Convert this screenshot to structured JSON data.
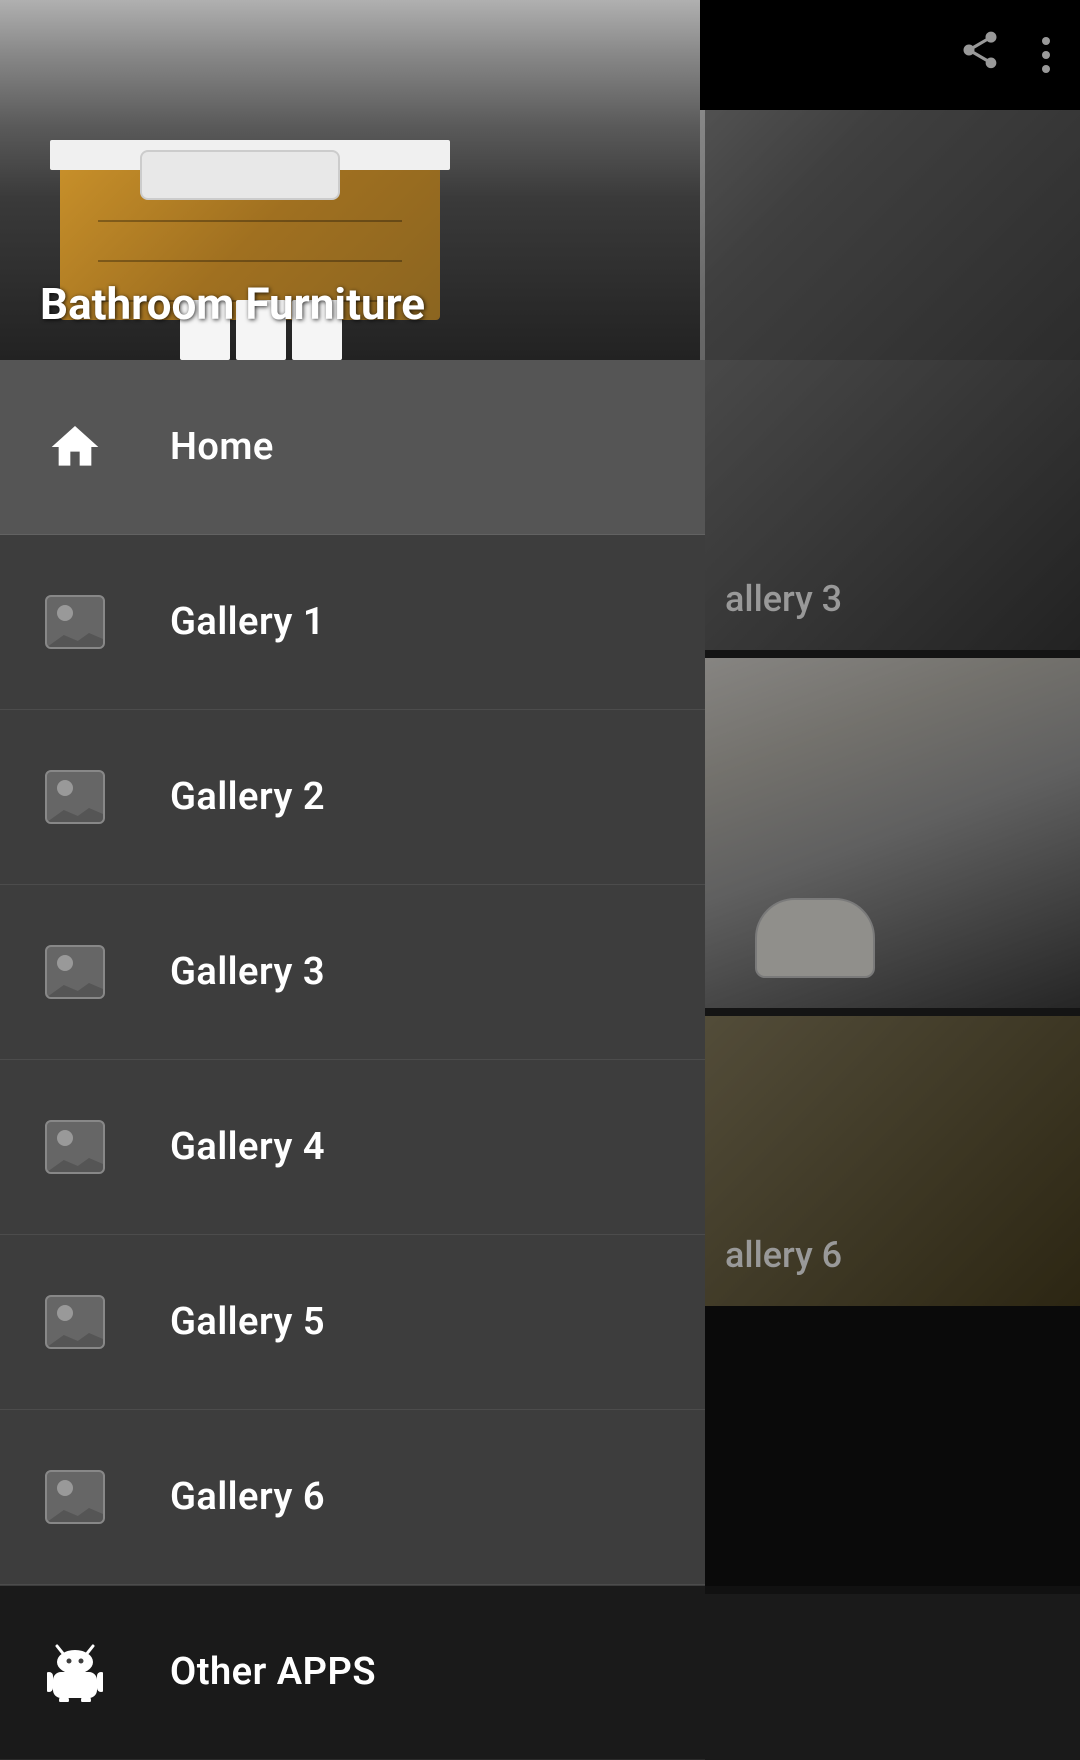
{
  "app": {
    "title": "Bathroom Furniture",
    "bg_color": "#1a1a1a"
  },
  "topbar": {
    "share_label": "share",
    "menu_label": "more options"
  },
  "hero": {
    "title": "Bathroom Furniture"
  },
  "drawer": {
    "items": [
      {
        "id": "home",
        "label": "Home",
        "icon": "home-icon"
      },
      {
        "id": "gallery1",
        "label": "Gallery 1",
        "icon": "image-icon"
      },
      {
        "id": "gallery2",
        "label": "Gallery 2",
        "icon": "image-icon"
      },
      {
        "id": "gallery3",
        "label": "Gallery 3",
        "icon": "image-icon"
      },
      {
        "id": "gallery4",
        "label": "Gallery 4",
        "icon": "image-icon"
      },
      {
        "id": "gallery5",
        "label": "Gallery 5",
        "icon": "image-icon"
      },
      {
        "id": "gallery6",
        "label": "Gallery 6",
        "icon": "image-icon"
      },
      {
        "id": "other-apps",
        "label": "Other APPS",
        "icon": "android-icon"
      }
    ]
  },
  "right_panel": {
    "gallery3_label": "allery 3",
    "gallery6_label": "allery 6"
  }
}
